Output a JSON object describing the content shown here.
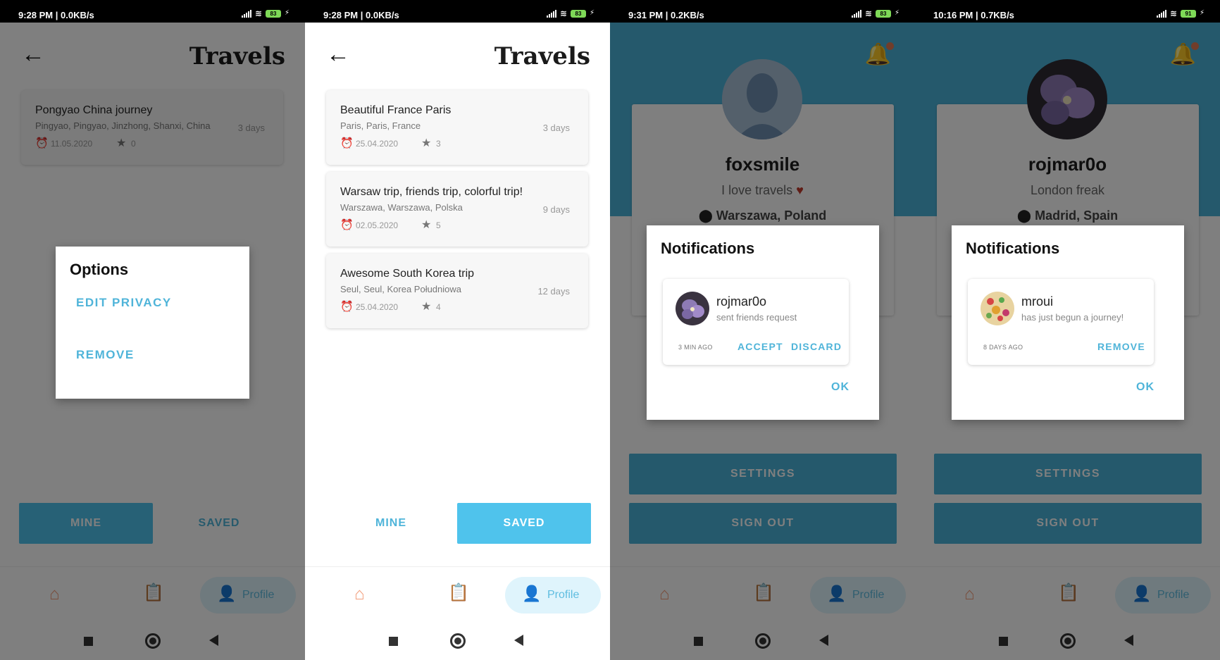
{
  "screens": [
    {
      "status_time": "9:28 PM | 0.0KB/s",
      "battery": "83",
      "title": "Travels",
      "trips": [
        {
          "name": "Pongyao China journey",
          "place": "Pingyao, Pingyao, Jinzhong, Shanxi, China",
          "days": "3 days",
          "date": "11.05.2020",
          "stars": "0"
        }
      ],
      "mine_label": "MINE",
      "saved_label": "SAVED",
      "active_tab": "mine",
      "options": {
        "title": "Options",
        "items": [
          "EDIT PRIVACY",
          "REMOVE"
        ]
      },
      "nav_profile": "Profile"
    },
    {
      "status_time": "9:28 PM | 0.0KB/s",
      "battery": "83",
      "title": "Travels",
      "trips": [
        {
          "name": "Beautiful France Paris",
          "place": "Paris, Paris, France",
          "days": "3 days",
          "date": "25.04.2020",
          "stars": "3"
        },
        {
          "name": "Warsaw trip, friends trip, colorful trip!",
          "place": "Warszawa, Warszawa, Polska",
          "days": "9 days",
          "date": "02.05.2020",
          "stars": "5"
        },
        {
          "name": "Awesome South Korea trip",
          "place": "Seul, Seul, Korea Południowa",
          "days": "12 days",
          "date": "25.04.2020",
          "stars": "4"
        }
      ],
      "mine_label": "MINE",
      "saved_label": "SAVED",
      "active_tab": "saved",
      "nav_profile": "Profile"
    },
    {
      "status_time": "9:31 PM | 0.2KB/s",
      "battery": "83",
      "username": "foxsmile",
      "bio": "I love travels",
      "location": "Warszawa, Poland",
      "notifications": {
        "title": "Notifications",
        "user": "rojmar0o",
        "message": "sent friends request",
        "time": "3 MIN AGO",
        "actions": [
          "ACCEPT",
          "DISCARD"
        ],
        "ok": "OK"
      },
      "settings_label": "SETTINGS",
      "signout_label": "SIGN OUT",
      "nav_profile": "Profile"
    },
    {
      "status_time": "10:16 PM | 0.7KB/s",
      "battery": "91",
      "username": "rojmar0o",
      "bio": "London freak",
      "location": "Madrid, Spain",
      "notifications": {
        "title": "Notifications",
        "user": "mroui",
        "message": "has just begun a journey!",
        "time": "8 DAYS AGO",
        "actions": [
          "REMOVE"
        ],
        "ok": "OK"
      },
      "settings_label": "SETTINGS",
      "signout_label": "SIGN OUT",
      "nav_profile": "Profile"
    }
  ],
  "colors": {
    "accent": "#4fc3ec",
    "profile_band": "#4bb3d9",
    "home_icon": "#f29d7a",
    "clipboard_icon": "#f7c35c"
  },
  "icons": [
    "back-arrow-icon",
    "alarm-clock-icon",
    "star-icon",
    "home-icon",
    "clipboard-icon",
    "person-icon",
    "bell-icon",
    "location-pin-icon",
    "heart-icon"
  ]
}
